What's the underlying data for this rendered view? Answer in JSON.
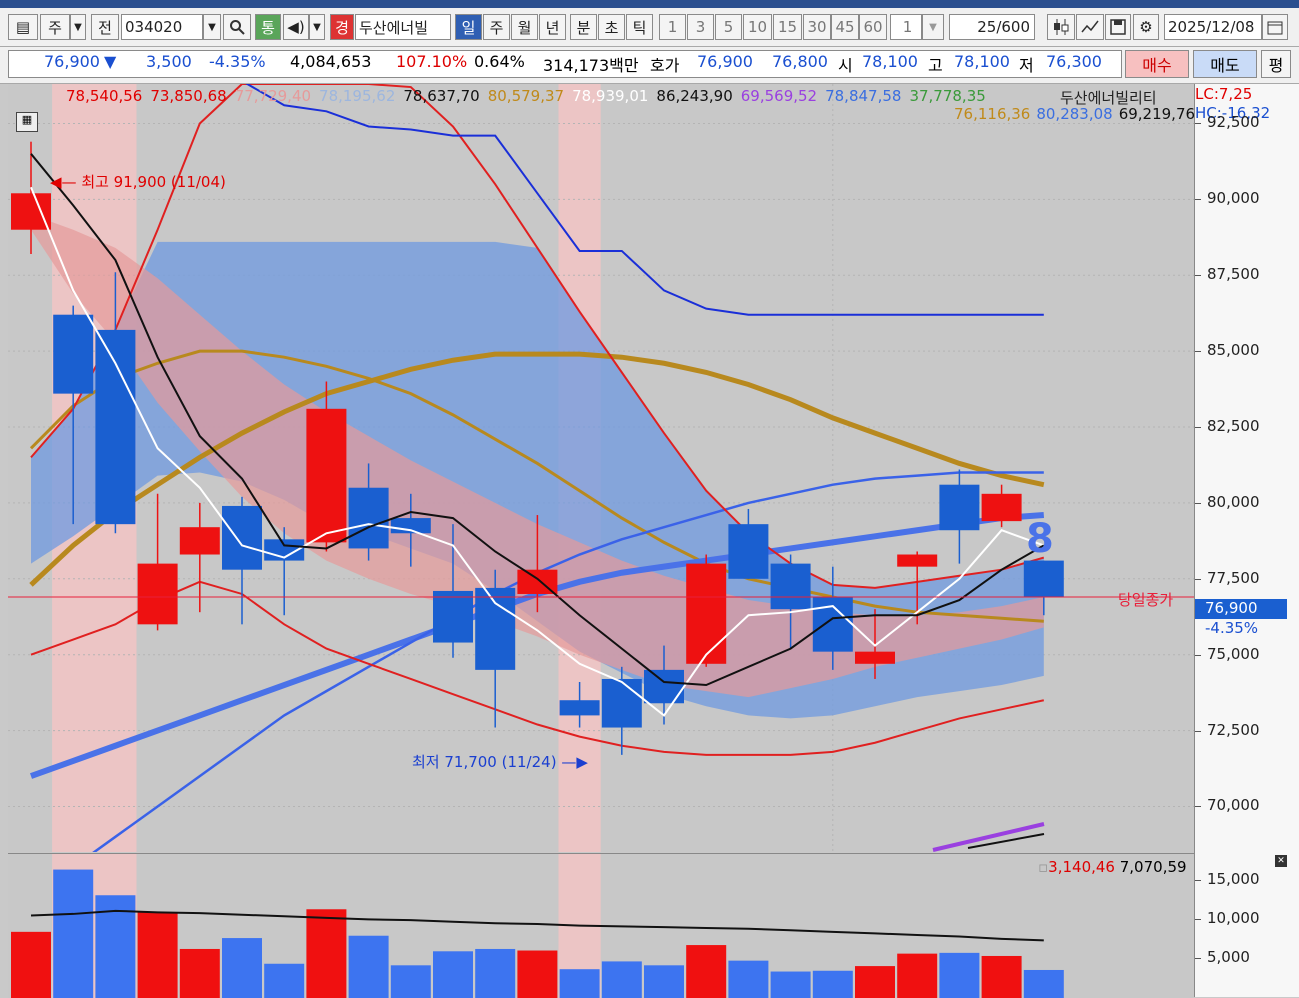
{
  "toolbar": {
    "market": "주",
    "prev": "전",
    "code": "034020",
    "tong": "통",
    "gyeong": "경",
    "name": "두산에너빌",
    "periods": [
      "일",
      "주",
      "월",
      "년",
      "분",
      "초",
      "틱"
    ],
    "intervals": [
      "1",
      "3",
      "5",
      "10",
      "15",
      "30",
      "45",
      "60"
    ],
    "n_value": "1",
    "count_value": "25",
    "count_total": "/600",
    "date": "2025/12/08"
  },
  "quote": {
    "price": "76,900",
    "arrow": "▼",
    "change": "3,500",
    "change_pct": "-4.35%",
    "volume": "4,084,653",
    "vol_ratio": "107.10%",
    "turnover": "0.64%",
    "amount": "314,173백만",
    "hoga_label": "호가",
    "ask": "76,900",
    "bid": "76,800",
    "open_label": "시",
    "open": "78,100",
    "high_label": "고",
    "high": "78,100",
    "low_label": "저",
    "low": "76,300",
    "buy_label": "매수",
    "sell_label": "매도",
    "flat_label": "평"
  },
  "legend": {
    "values": [
      {
        "text": "78,540,56",
        "color": "#e00000"
      },
      {
        "text": "73,850,68",
        "color": "#e00000"
      },
      {
        "text": "77,729,40",
        "color": "#e69a9a"
      },
      {
        "text": "78,195,62",
        "color": "#9db6de"
      },
      {
        "text": "78,637,70",
        "color": "#111111"
      },
      {
        "text": "80,579,37",
        "color": "#c08a1a"
      },
      {
        "text": "78,939,01",
        "color": "#ffffff"
      },
      {
        "text": "86,243,90",
        "color": "#111111"
      },
      {
        "text": "69,569,52",
        "color": "#9a40e0"
      },
      {
        "text": "78,847,58",
        "color": "#3a6ee0"
      },
      {
        "text": "37,778,35",
        "color": "#3a9a3a"
      }
    ],
    "name": "두산에너빌리티",
    "row2": [
      {
        "text": "76,116,36",
        "color": "#c08a1a"
      },
      {
        "text": "80,283,08",
        "color": "#3a6ee0"
      },
      {
        "text": "69,219,76",
        "color": "#111111"
      }
    ],
    "lc": "LC:7,25",
    "hc": "HC:-16,32"
  },
  "annotations": {
    "high": "최고 91,900 (11/04)",
    "low": "최저 71,700 (11/24)",
    "close_label": "당일종가",
    "close_value": "76,900",
    "close_pct": "-4.35%",
    "count_mark": "8"
  },
  "volume_legend": {
    "a": "3,140,46",
    "b": "7,070,59"
  },
  "price_axis": [
    "92,500",
    "90,000",
    "87,500",
    "85,000",
    "82,500",
    "80,000",
    "77,500",
    "75,000",
    "72,500",
    "70,000"
  ],
  "volume_axis": [
    "15,000",
    "10,000",
    "5,000"
  ],
  "colors": {
    "up": "#ee1111",
    "down": "#1a5fd0",
    "close_line": "#e8203a",
    "highlight": "#f2c4c4"
  },
  "chart_data": {
    "type": "candlestick",
    "y_range": [
      68500,
      93800
    ],
    "candles": [
      {
        "o": 89000,
        "h": 91900,
        "l": 88200,
        "c": 90200
      },
      {
        "o": 86200,
        "h": 86500,
        "l": 79300,
        "c": 83600
      },
      {
        "o": 85700,
        "h": 87600,
        "l": 79000,
        "c": 79300
      },
      {
        "o": 76000,
        "h": 80300,
        "l": 75800,
        "c": 78000
      },
      {
        "o": 78300,
        "h": 80000,
        "l": 76400,
        "c": 79200
      },
      {
        "o": 79900,
        "h": 80200,
        "l": 76000,
        "c": 77800
      },
      {
        "o": 78800,
        "h": 79200,
        "l": 76300,
        "c": 78100
      },
      {
        "o": 78700,
        "h": 84000,
        "l": 78400,
        "c": 83100
      },
      {
        "o": 80500,
        "h": 81300,
        "l": 78100,
        "c": 78500
      },
      {
        "o": 79500,
        "h": 80300,
        "l": 77900,
        "c": 79000
      },
      {
        "o": 77100,
        "h": 79300,
        "l": 74900,
        "c": 75400
      },
      {
        "o": 77200,
        "h": 77800,
        "l": 72600,
        "c": 74500
      },
      {
        "o": 77000,
        "h": 79600,
        "l": 76400,
        "c": 77800
      },
      {
        "o": 73500,
        "h": 74100,
        "l": 72600,
        "c": 73000
      },
      {
        "o": 74200,
        "h": 74600,
        "l": 71700,
        "c": 72600
      },
      {
        "o": 74500,
        "h": 75300,
        "l": 72700,
        "c": 73400
      },
      {
        "o": 74700,
        "h": 78300,
        "l": 74600,
        "c": 78000
      },
      {
        "o": 79300,
        "h": 79800,
        "l": 77500,
        "c": 77500
      },
      {
        "o": 78000,
        "h": 78300,
        "l": 75200,
        "c": 76500
      },
      {
        "o": 76900,
        "h": 77900,
        "l": 74500,
        "c": 75100
      },
      {
        "o": 74700,
        "h": 76500,
        "l": 74200,
        "c": 75100
      },
      {
        "o": 77900,
        "h": 78400,
        "l": 76000,
        "c": 78300
      },
      {
        "o": 80600,
        "h": 81100,
        "l": 78000,
        "c": 79100
      },
      {
        "o": 79400,
        "h": 80600,
        "l": 79200,
        "c": 80300
      },
      {
        "o": 78100,
        "h": 78100,
        "l": 76300,
        "c": 76900
      }
    ],
    "volumes": [
      8500,
      16500,
      13200,
      11000,
      6300,
      7700,
      4400,
      11400,
      8000,
      4200,
      6000,
      6300,
      6100,
      3700,
      4700,
      4200,
      6800,
      4800,
      3400,
      3500,
      4100,
      5700,
      5800,
      5400,
      3600
    ],
    "vol_ma": [
      10600,
      10800,
      11200,
      11000,
      10900,
      10700,
      10500,
      10300,
      10100,
      10000,
      9800,
      9600,
      9500,
      9300,
      9200,
      9100,
      9000,
      8900,
      8700,
      8500,
      8300,
      8100,
      7900,
      7600,
      7400
    ],
    "ma5": [
      90400,
      87000,
      84600,
      81800,
      80500,
      78600,
      78200,
      79000,
      79300,
      79100,
      78600,
      76700,
      75800,
      74700,
      74100,
      73000,
      75000,
      76300,
      76400,
      76600,
      75300,
      76400,
      77500,
      79100,
      78600
    ],
    "ma10": [
      91500,
      89800,
      88000,
      84800,
      82200,
      80800,
      78600,
      78500,
      79200,
      79700,
      79500,
      78400,
      77500,
      76300,
      75200,
      74100,
      74000,
      74600,
      75200,
      76200,
      76300,
      76300,
      76800,
      77800,
      78600
    ],
    "env_upper": [
      89500,
      89000,
      88400,
      87400,
      86200,
      85000,
      83900,
      83000,
      82200,
      81400,
      80700,
      80000,
      79300,
      78700,
      78100,
      77600,
      77200,
      76800,
      76600,
      76400,
      76300,
      76300,
      76400,
      76600,
      76900
    ],
    "env_lower": [
      89000,
      86900,
      85300,
      83300,
      81700,
      80200,
      79000,
      78100,
      77500,
      77000,
      76600,
      76100,
      75600,
      75000,
      74500,
      74000,
      73800,
      73600,
      73900,
      74200,
      74600,
      74900,
      75200,
      75500,
      75900
    ],
    "band_top": [
      81500,
      83100,
      85700,
      89000,
      92500,
      94500,
      95200,
      95000,
      94500,
      93700,
      92400,
      90500,
      88400,
      86300,
      84300,
      82300,
      80400,
      79000,
      78000,
      77300,
      77200,
      77400,
      77600,
      77800,
      78200
    ],
    "band_mid": [
      78000,
      78900,
      79900,
      80900,
      81000,
      80700,
      80100,
      79300,
      79000,
      78500,
      78000,
      77100,
      76100,
      75100,
      74400,
      73700,
      73300,
      73000,
      72900,
      73000,
      73300,
      73600,
      73800,
      74000,
      74300
    ],
    "band_bot": [
      75000,
      75500,
      76000,
      76800,
      77400,
      77000,
      76000,
      75200,
      74700,
      74200,
      73700,
      73200,
      72700,
      72300,
      72000,
      71800,
      71700,
      71700,
      71700,
      71800,
      72100,
      72500,
      72900,
      73200,
      73500
    ],
    "line_blue_top": [
      null,
      null,
      95000,
      95200,
      94500,
      93900,
      93100,
      92900,
      92400,
      92300,
      92100,
      92100,
      90200,
      88300,
      88300,
      87000,
      86400,
      86200,
      86200,
      86200,
      86200,
      86200,
      86200,
      86200,
      86200
    ],
    "trend_a": [
      71000,
      71500,
      72000,
      72500,
      73000,
      73500,
      74000,
      74500,
      75000,
      75500,
      76000,
      76500,
      77000,
      77400,
      77700,
      77900,
      78100,
      78300,
      78500,
      78700,
      78900,
      79100,
      79300,
      79500,
      79600
    ],
    "trend_b": [
      67000,
      68000,
      69000,
      70000,
      71000,
      72000,
      73000,
      73800,
      74600,
      75400,
      76200,
      77000,
      77700,
      78300,
      78800,
      79200,
      79600,
      80000,
      80300,
      80600,
      80800,
      80900,
      81000,
      81000,
      81000
    ],
    "curve_gold_thick": [
      77300,
      78600,
      79700,
      80600,
      81500,
      82300,
      83000,
      83600,
      84000,
      84400,
      84700,
      84900,
      84900,
      84900,
      84800,
      84600,
      84300,
      83900,
      83400,
      82800,
      82300,
      81800,
      81300,
      80900,
      80600
    ],
    "curve_gold_thin": [
      81800,
      83200,
      84100,
      84600,
      85000,
      85000,
      84800,
      84500,
      84100,
      83600,
      82900,
      82100,
      81300,
      80400,
      79500,
      78700,
      78000,
      77500,
      77200,
      76900,
      76600,
      76400,
      76300,
      76200,
      76100
    ]
  }
}
